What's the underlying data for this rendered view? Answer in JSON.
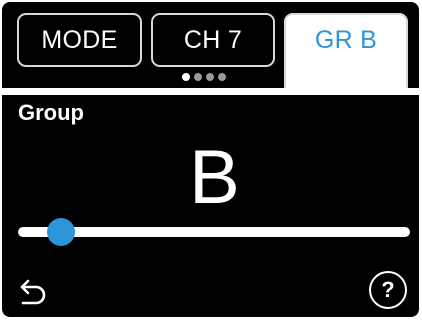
{
  "tabs": [
    {
      "label": "MODE",
      "active": false
    },
    {
      "label": "CH 7",
      "active": false
    },
    {
      "label": "GR B",
      "active": true
    }
  ],
  "page_indicator": {
    "total": 4,
    "current": 1
  },
  "setting": {
    "label": "Group",
    "value": "B"
  },
  "slider": {
    "position": 0.11
  },
  "icons": {
    "back": "back-arrow-icon",
    "help": "question-mark-icon",
    "help_glyph": "?"
  },
  "colors": {
    "background": "#000000",
    "accent": "#2c95d8",
    "text": "#ffffff",
    "tab_border": "#d8d8d8"
  }
}
